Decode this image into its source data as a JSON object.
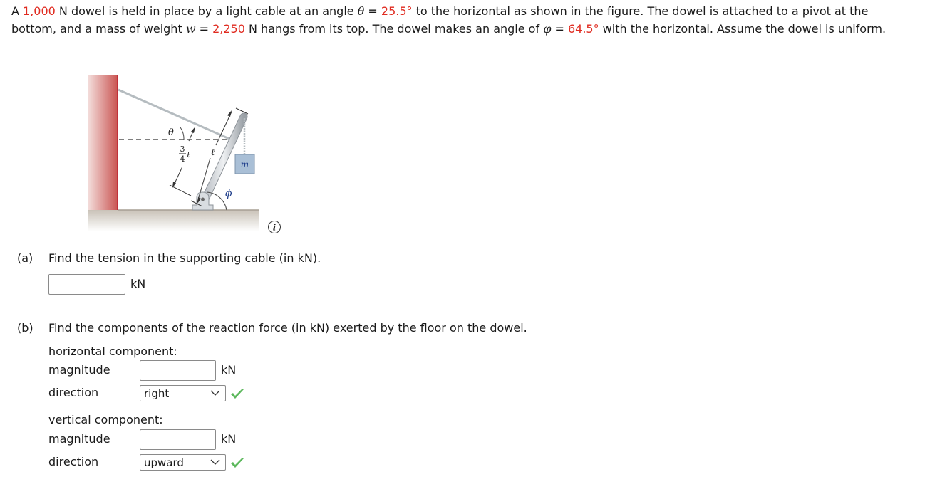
{
  "problem": {
    "t1": "A ",
    "dowel_weight": "1,000",
    "t2": " N dowel is held in place by a light cable at an angle ",
    "theta_sym": "θ",
    "t3": " = ",
    "theta_val": "25.5°",
    "t4": " to the horizontal as shown in the figure. The dowel is attached to a pivot at the bottom, and a mass of weight ",
    "w_sym": "w",
    "t5": " = ",
    "w_val": "2,250",
    "t6": " N hangs from its top. The dowel makes an angle of ",
    "phi_sym": "φ",
    "t7": " = ",
    "phi_val": "64.5°",
    "t8": " with the horizontal. Assume the dowel is uniform."
  },
  "figure": {
    "theta_label": "θ",
    "frac_num": "3",
    "frac_den": "4",
    "ell": "ℓ",
    "mass_label": "m",
    "phi_label": "ϕ",
    "info_glyph": "i"
  },
  "part_a": {
    "label": "(a)",
    "question": "Find the tension in the supporting cable (in kN).",
    "answer_value": "",
    "unit": "kN"
  },
  "part_b": {
    "label": "(b)",
    "question": "Find the components of the reaction force (in kN) exerted by the floor on the dowel.",
    "horizontal": {
      "heading": "horizontal component:",
      "magnitude_label": "magnitude",
      "magnitude_value": "",
      "unit": "kN",
      "direction_label": "direction",
      "direction_selected": "right",
      "direction_correct": true
    },
    "vertical": {
      "heading": "vertical component:",
      "magnitude_label": "magnitude",
      "magnitude_value": "",
      "unit": "kN",
      "direction_label": "direction",
      "direction_selected": "upward",
      "direction_correct": true
    }
  },
  "colors": {
    "given_value": "#e02b20",
    "check": "#5cb85c",
    "wall": "#c9524f"
  }
}
